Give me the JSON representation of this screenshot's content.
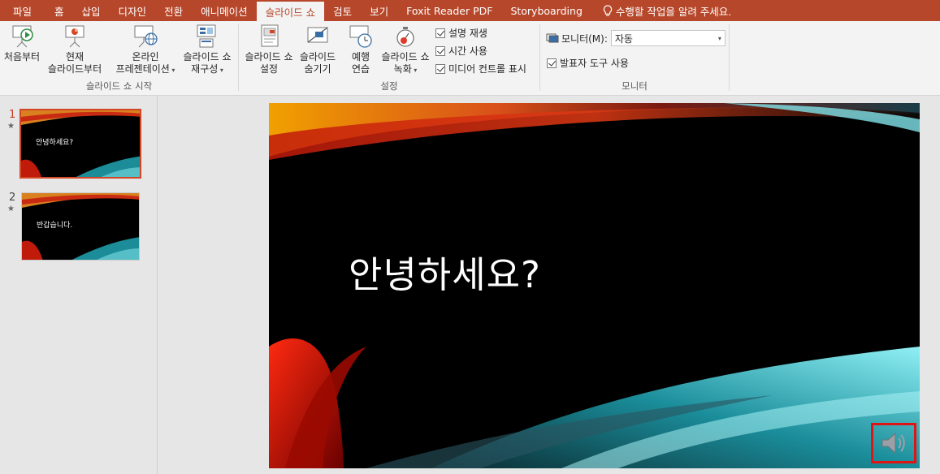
{
  "tabs": [
    {
      "label": "파일"
    },
    {
      "label": "홈"
    },
    {
      "label": "삽입"
    },
    {
      "label": "디자인"
    },
    {
      "label": "전환"
    },
    {
      "label": "애니메이션"
    },
    {
      "label": "슬라이드 쇼",
      "active": true
    },
    {
      "label": "검토"
    },
    {
      "label": "보기"
    },
    {
      "label": "Foxit Reader PDF"
    },
    {
      "label": "Storyboarding"
    }
  ],
  "tell_me": "수행할 작업을 알려 주세요.",
  "ribbon": {
    "start_group": {
      "label": "슬라이드 쇼 시작",
      "from_beginning": "처음부터",
      "from_current_1": "현재",
      "from_current_2": "슬라이드부터",
      "online_1": "온라인",
      "online_2": "프레젠테이션",
      "custom_1": "슬라이드 쇼",
      "custom_2": "재구성"
    },
    "setup_group": {
      "label": "설정",
      "setup_1": "슬라이드 쇼",
      "setup_2": "설정",
      "hide_1": "슬라이드",
      "hide_2": "숨기기",
      "rehearse_1": "예행",
      "rehearse_2": "연습",
      "record_1": "슬라이드 쇼",
      "record_2": "녹화",
      "play_narrations": "설명 재생",
      "use_timings": "시간 사용",
      "show_media_controls": "미디어 컨트롤 표시"
    },
    "monitor_group": {
      "label": "모니터",
      "monitor_label": "모니터(M):",
      "monitor_value": "자동",
      "presenter_view": "발표자 도구 사용"
    }
  },
  "slides": [
    {
      "number": "1",
      "text": "안녕하세요?"
    },
    {
      "number": "2",
      "text": "반갑습니다."
    }
  ],
  "current_slide_title": "안녕하세요?",
  "colors": {
    "accent": "#b7472a",
    "highlight": "#e01414"
  }
}
